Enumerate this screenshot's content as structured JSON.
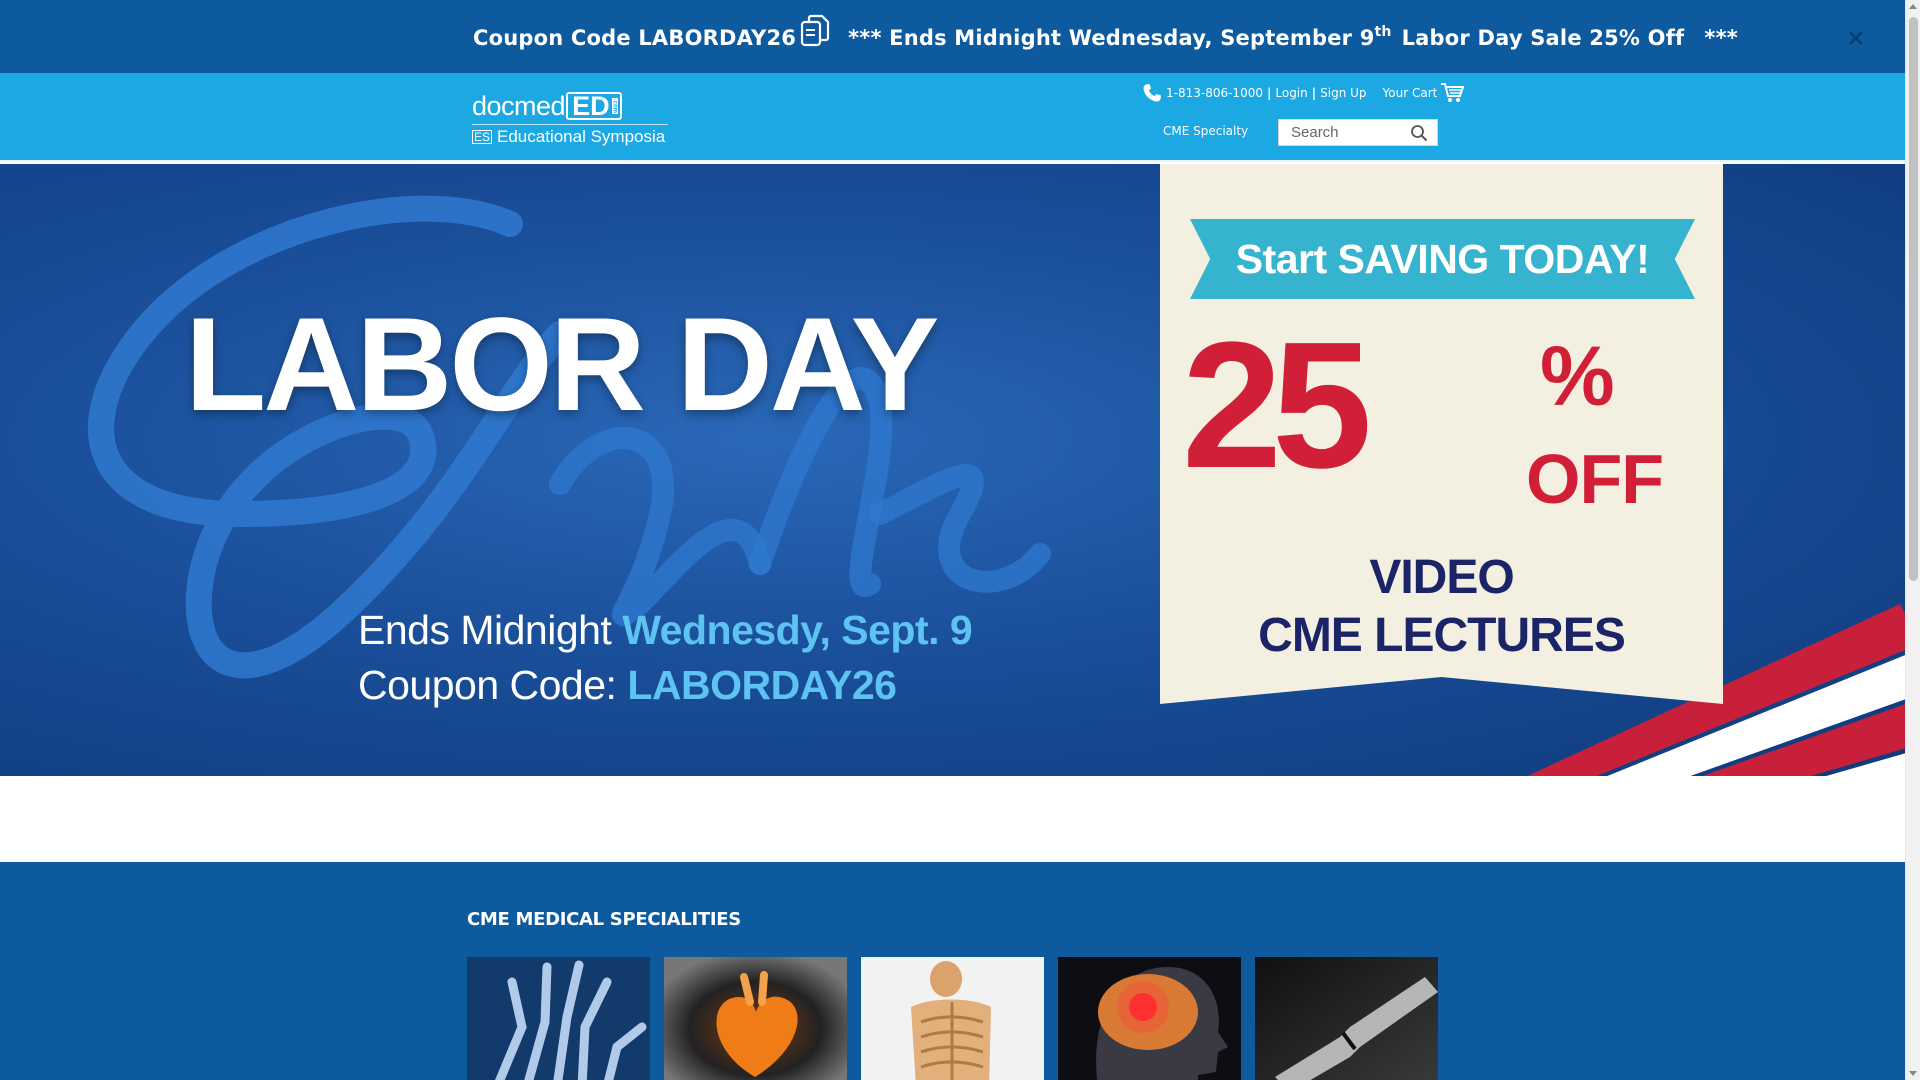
{
  "promo": {
    "coupon_label": "Coupon Code LABORDAY26",
    "ends_text": "*** Ends Midnight Wednesday, September 9",
    "ends_sup": "th",
    "sale_text": "Labor Day Sale 25% Off",
    "trailing": "***",
    "close_symbol": "✕"
  },
  "header": {
    "logo_doc": "docmed",
    "logo_ed": "ED",
    "logo_com": ".com",
    "logo_es": "ES",
    "logo_tagline": "Educational Symposia",
    "phone": "1-813-806-1000",
    "sep": "|",
    "login": "Login",
    "signup": "Sign Up",
    "cart": "Your Cart",
    "cme_specialty": "CME Specialty",
    "search_placeholder": "Search"
  },
  "hero": {
    "title": "LABOR DAY",
    "script_word": "Sale",
    "line1_prefix": "Ends Midnight ",
    "line1_highlight": "Wednesdy, Sept. 9",
    "line2_prefix": "Coupon Code: ",
    "line2_highlight": "LABORDAY26",
    "ribbon": "Start SAVING TODAY!",
    "percent_number": "25",
    "percent_sign": "%",
    "off": "OFF",
    "video": "VIDEO",
    "cme_lectures": "CME LECTURES"
  },
  "specialities": {
    "heading": "CME MEDICAL SPECIALITIES",
    "tiles": [
      {
        "name": "hand-xray"
      },
      {
        "name": "heart"
      },
      {
        "name": "skeleton"
      },
      {
        "name": "brain"
      },
      {
        "name": "bone-fracture-xray"
      }
    ]
  },
  "colors": {
    "promo_bar": "#0d5a9f",
    "header": "#1ca8e3",
    "hero_blue": "#1a4f9a",
    "accent_red": "#d11f37",
    "ribbon_teal": "#36b3cf",
    "navy_text": "#1b2467"
  },
  "icons": {
    "copy": "copy-icon",
    "close": "close-icon",
    "phone": "phone-icon",
    "cart": "cart-icon",
    "search": "search-icon"
  }
}
